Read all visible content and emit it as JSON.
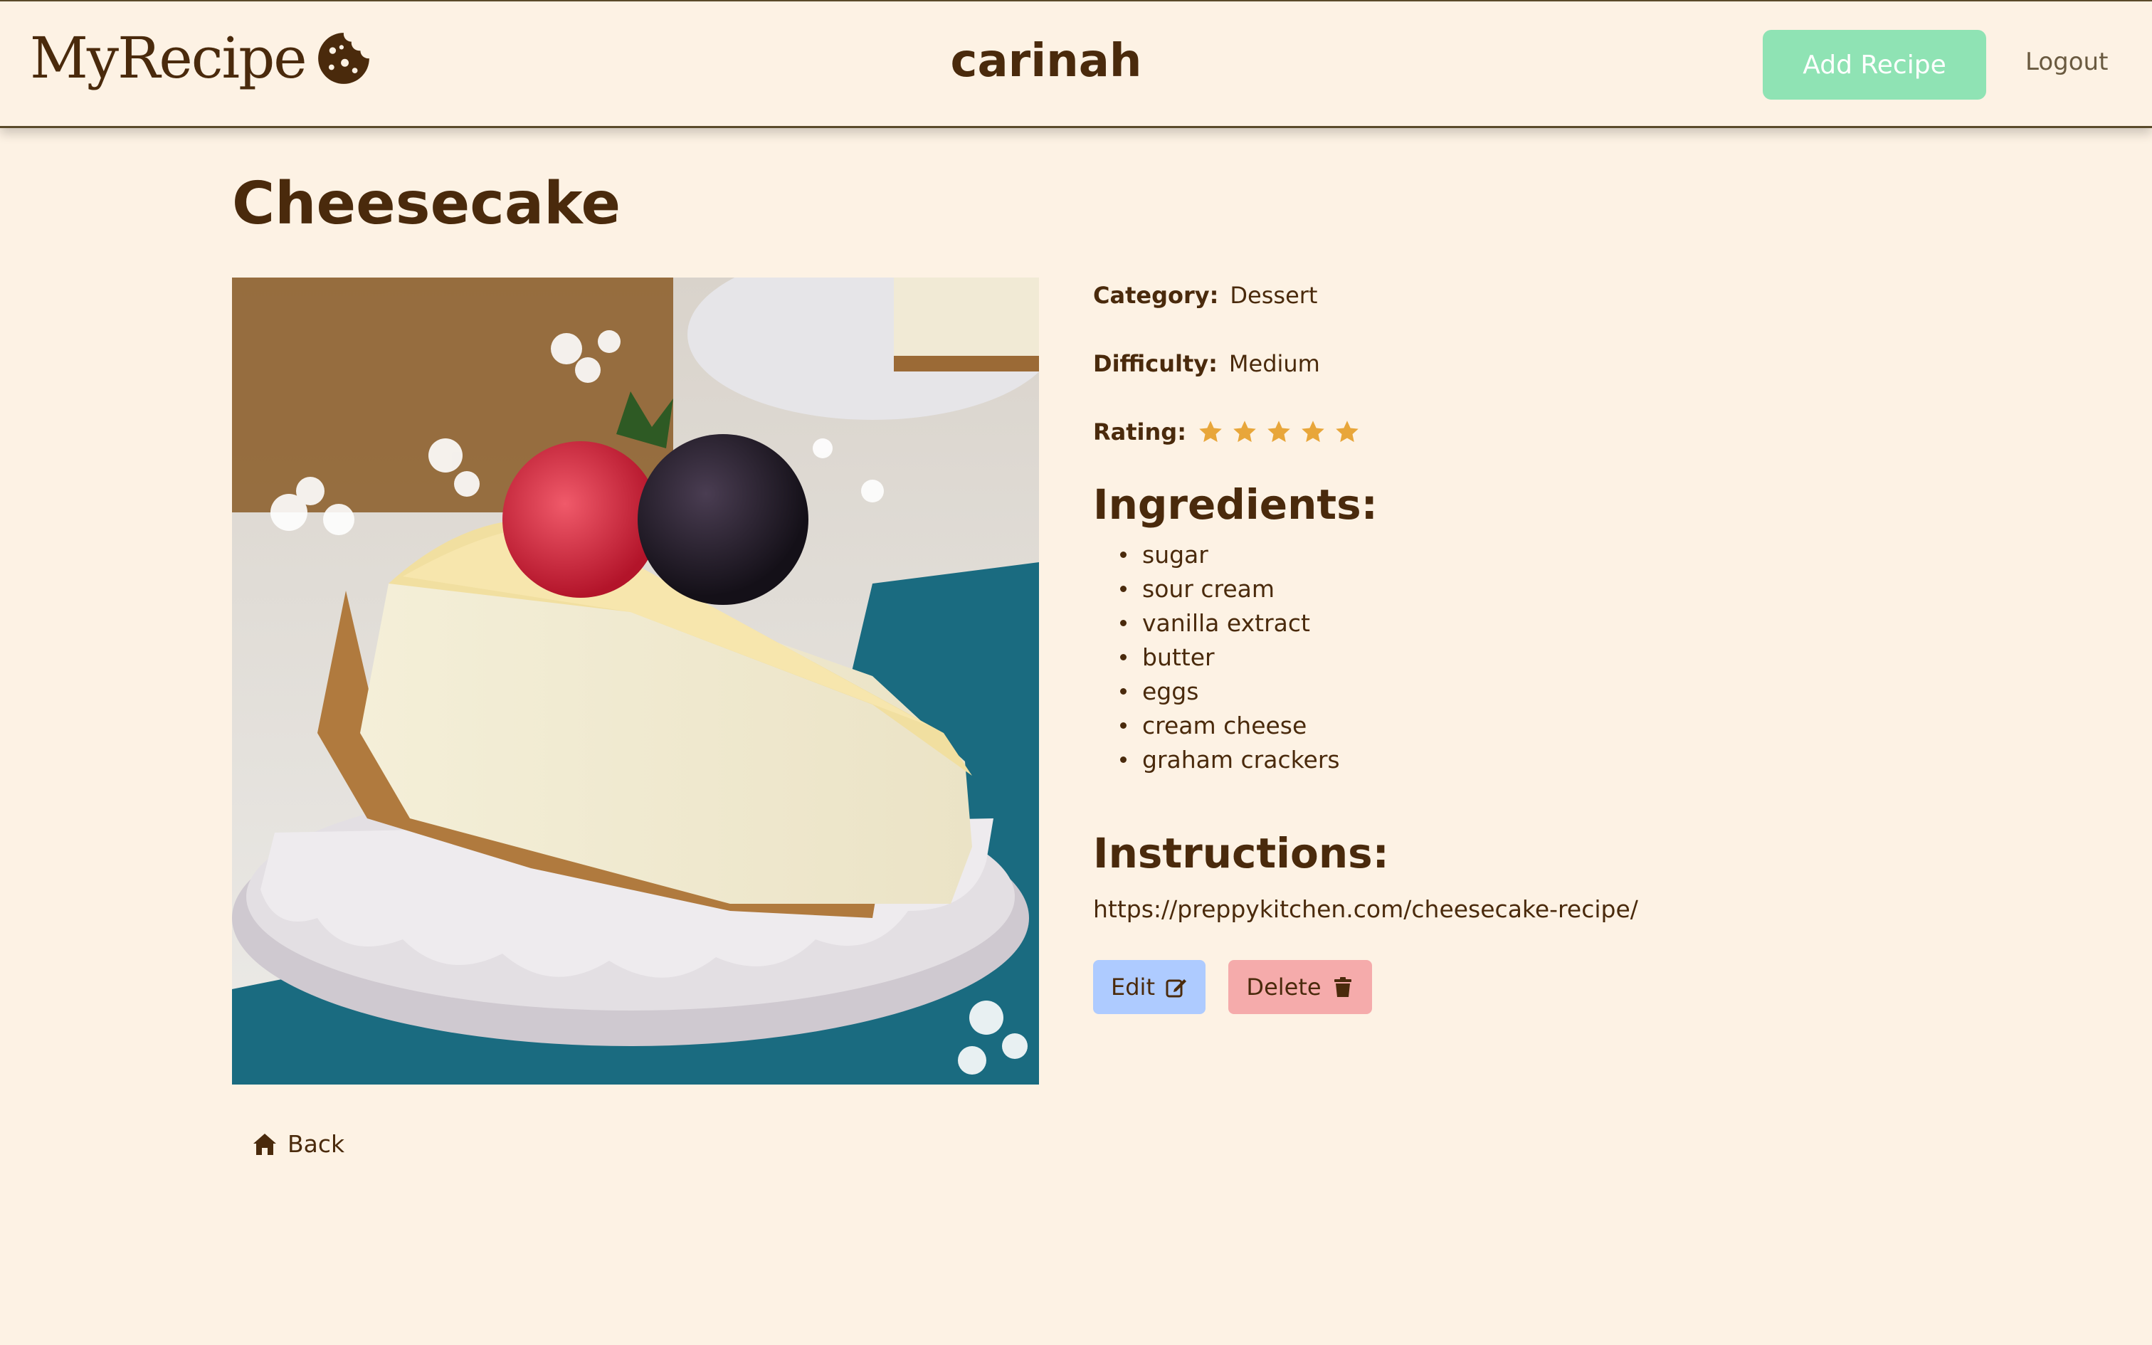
{
  "header": {
    "brand": "MyRecipe",
    "brand_icon": "cookie-icon",
    "username": "carinah",
    "add_recipe_label": "Add Recipe",
    "logout_label": "Logout"
  },
  "recipe": {
    "title": "Cheesecake",
    "image_icon": "cheesecake-photo",
    "category_label": "Category:",
    "category": "Dessert",
    "difficulty_label": "Difficulty:",
    "difficulty": "Medium",
    "rating_label": "Rating:",
    "rating": 5,
    "rating_max": 5,
    "ingredients_title": "Ingredients:",
    "ingredients": [
      "sugar",
      "sour cream",
      "vanilla extract",
      "butter",
      "eggs",
      "cream cheese",
      "graham crackers"
    ],
    "instructions_title": "Instructions:",
    "instructions": "https://preppykitchen.com/cheesecake-recipe/"
  },
  "actions": {
    "edit_label": "Edit",
    "edit_icon": "edit-icon",
    "delete_label": "Delete",
    "delete_icon": "trash-icon"
  },
  "nav": {
    "back_label": "Back",
    "back_icon": "home-icon"
  },
  "colors": {
    "background": "#fdf2e4",
    "text": "#4a2a0c",
    "add_button": "#8fe3b4",
    "edit_button": "#aecbff",
    "delete_button": "#f5abab",
    "star": "#e8a63a"
  }
}
